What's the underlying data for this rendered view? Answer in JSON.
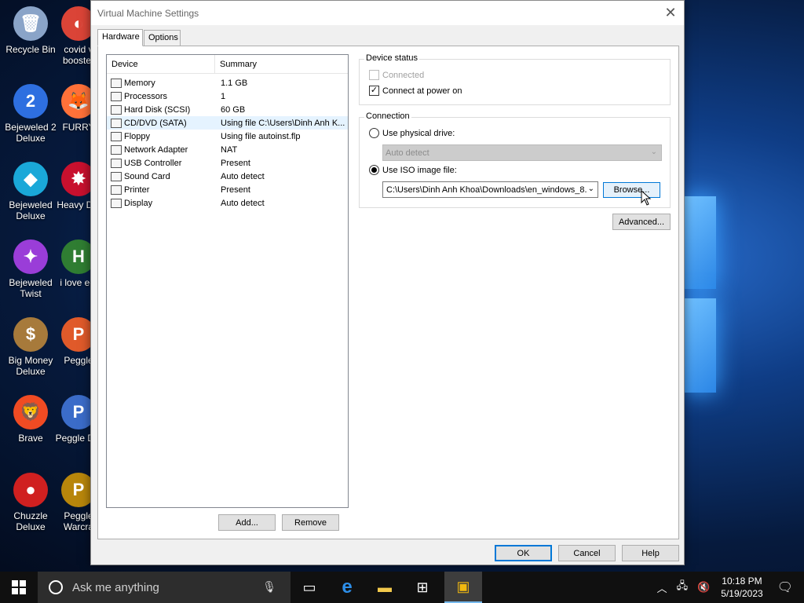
{
  "desktop": {
    "icons": [
      {
        "label": "Recycle Bin",
        "color": "#8aa4c8",
        "glyph": "🗑"
      },
      {
        "label": "Bejeweled 2 Deluxe",
        "color": "#2e6fe0",
        "glyph": "2"
      },
      {
        "label": "Bejeweled Deluxe",
        "color": "#1aa8d8",
        "glyph": "◆"
      },
      {
        "label": "Bejeweled Twist",
        "color": "#9a3dd8",
        "glyph": "✦"
      },
      {
        "label": "Big Money Deluxe",
        "color": "#a77a3b",
        "glyph": "$"
      },
      {
        "label": "Brave",
        "color": "#f04b23",
        "glyph": "🦁"
      },
      {
        "label": "Chuzzle Deluxe",
        "color": "#d02020",
        "glyph": "●"
      }
    ],
    "icons_col2": [
      {
        "label": "covid v booster",
        "color": "#db4437",
        "glyph": "◐"
      },
      {
        "label": "FURRY",
        "color": "#ff7139",
        "glyph": "🦊"
      },
      {
        "label": "Heavy Del",
        "color": "#c8102e",
        "glyph": "✸"
      },
      {
        "label": "i love edi",
        "color": "#2f7d32",
        "glyph": "H"
      },
      {
        "label": "Peggle",
        "color": "#e05a2a",
        "glyph": "P"
      },
      {
        "label": "Peggle Del",
        "color": "#3b6cc9",
        "glyph": "P"
      },
      {
        "label": "Peggle Warcra",
        "color": "#b8860b",
        "glyph": "P"
      }
    ]
  },
  "dialog": {
    "title": "Virtual Machine Settings",
    "tabs": [
      "Hardware",
      "Options"
    ],
    "list": {
      "col_device": "Device",
      "col_summary": "Summary",
      "rows": [
        {
          "device": "Memory",
          "summary": "1.1 GB",
          "icon": "memory-icon"
        },
        {
          "device": "Processors",
          "summary": "1",
          "icon": "processor-icon"
        },
        {
          "device": "Hard Disk (SCSI)",
          "summary": "60 GB",
          "icon": "hard-disk-icon"
        },
        {
          "device": "CD/DVD (SATA)",
          "summary": "Using file C:\\Users\\Dinh Anh K...",
          "icon": "cd-dvd-icon"
        },
        {
          "device": "Floppy",
          "summary": "Using file autoinst.flp",
          "icon": "floppy-icon"
        },
        {
          "device": "Network Adapter",
          "summary": "NAT",
          "icon": "network-adapter-icon"
        },
        {
          "device": "USB Controller",
          "summary": "Present",
          "icon": "usb-controller-icon"
        },
        {
          "device": "Sound Card",
          "summary": "Auto detect",
          "icon": "sound-card-icon"
        },
        {
          "device": "Printer",
          "summary": "Present",
          "icon": "printer-icon"
        },
        {
          "device": "Display",
          "summary": "Auto detect",
          "icon": "display-icon"
        }
      ],
      "selected_index": 3
    },
    "add_label": "Add...",
    "remove_label": "Remove",
    "device_status": {
      "title": "Device status",
      "connected_label": "Connected",
      "connected_checked": false,
      "connect_power_label": "Connect at power on",
      "connect_power_checked": true
    },
    "connection": {
      "title": "Connection",
      "physical_label": "Use physical drive:",
      "physical_value": "Auto detect",
      "iso_label": "Use ISO image file:",
      "iso_value": "C:\\Users\\Dinh Anh Khoa\\Downloads\\en_windows_8.",
      "selected": "iso"
    },
    "browse_label": "Browse...",
    "advanced_label": "Advanced...",
    "ok_label": "OK",
    "cancel_label": "Cancel",
    "help_label": "Help"
  },
  "taskbar": {
    "search_placeholder": "Ask me anything",
    "time": "10:18 PM",
    "date": "5/19/2023"
  }
}
